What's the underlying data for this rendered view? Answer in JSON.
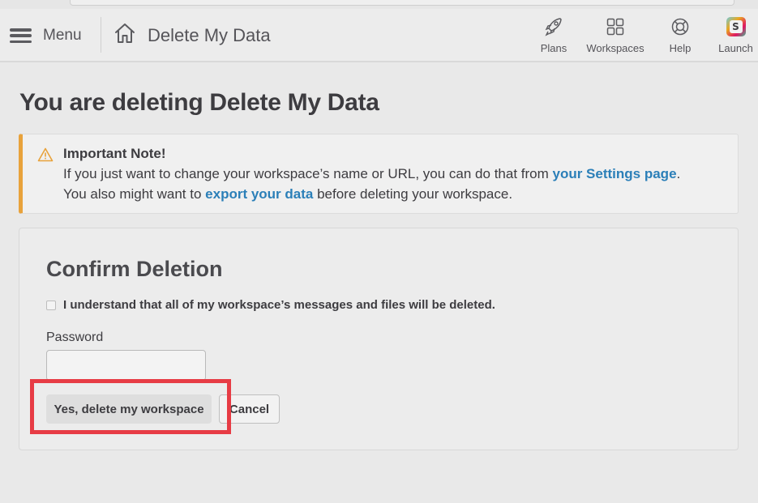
{
  "header": {
    "menu_label": "Menu",
    "breadcrumb_title": "Delete My Data",
    "nav": [
      {
        "label": "Plans",
        "icon": "rocket-icon"
      },
      {
        "label": "Workspaces",
        "icon": "grid-icon"
      },
      {
        "label": "Help",
        "icon": "lifebuoy-icon"
      },
      {
        "label": "Launch",
        "icon": "slack-logo-icon"
      }
    ],
    "launch_badge_letter": "S"
  },
  "page": {
    "title": "You are deleting Delete My Data"
  },
  "note": {
    "title": "Important Note!",
    "line1_pre": "If you just want to change your workspace’s name or URL, you can do that from ",
    "line1_link": "your Settings page",
    "line1_post": ".",
    "line2_pre": "You also might want to ",
    "line2_link": "export your data",
    "line2_post": " before deleting your workspace.",
    "accent_color": "#e8a23b",
    "link_color": "#2b7fb8"
  },
  "confirm": {
    "title": "Confirm Deletion",
    "checkbox_label": "I understand that all of my workspace’s messages and files will be deleted.",
    "password_label": "Password",
    "password_value": "",
    "delete_button": "Yes, delete my workspace",
    "cancel_button": "Cancel",
    "highlight_color": "#e73c45"
  }
}
